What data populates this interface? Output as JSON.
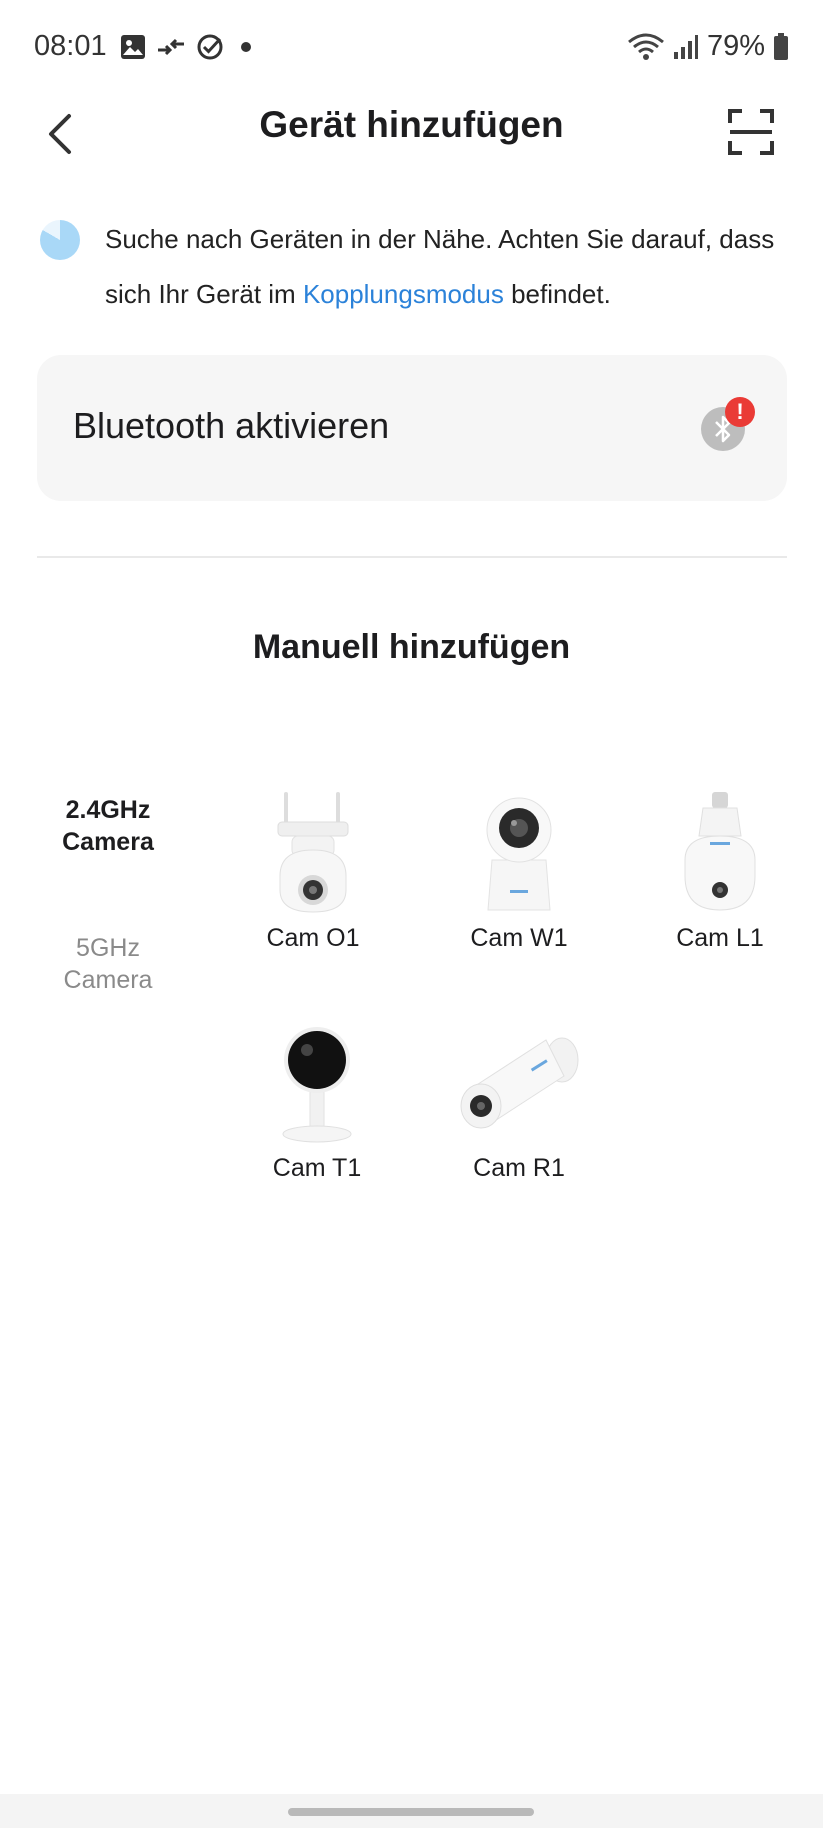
{
  "status_bar": {
    "time": "08:01",
    "battery": "79%",
    "icons": [
      "gallery-icon",
      "transfer-icon",
      "check-circle-icon",
      "dot-icon",
      "wifi-icon",
      "signal-icon",
      "battery-icon"
    ]
  },
  "header": {
    "title": "Gerät hinzufügen",
    "back_icon": "chevron-left-icon",
    "scan_icon": "scan-frame-icon"
  },
  "info": {
    "text_before": "Suche nach Geräten in der Nähe. Achten Sie darauf, dass sich Ihr Gerät im ",
    "link": "Kopplungsmodus",
    "text_after": " befindet."
  },
  "bluetooth": {
    "label": "Bluetooth aktivieren",
    "alert": "!",
    "icon": "bluetooth-icon"
  },
  "manual": {
    "title": "Manuell hinzufügen"
  },
  "categories": {
    "active": "2.4GHz Camera",
    "inactive": "5GHz Camera"
  },
  "devices": [
    {
      "name": "Cam O1"
    },
    {
      "name": "Cam W1"
    },
    {
      "name": "Cam L1"
    },
    {
      "name": "Cam T1"
    },
    {
      "name": "Cam R1"
    }
  ],
  "colors": {
    "accent": "#2b82d9",
    "alert": "#ea3b36",
    "card_bg": "#f6f6f6"
  }
}
